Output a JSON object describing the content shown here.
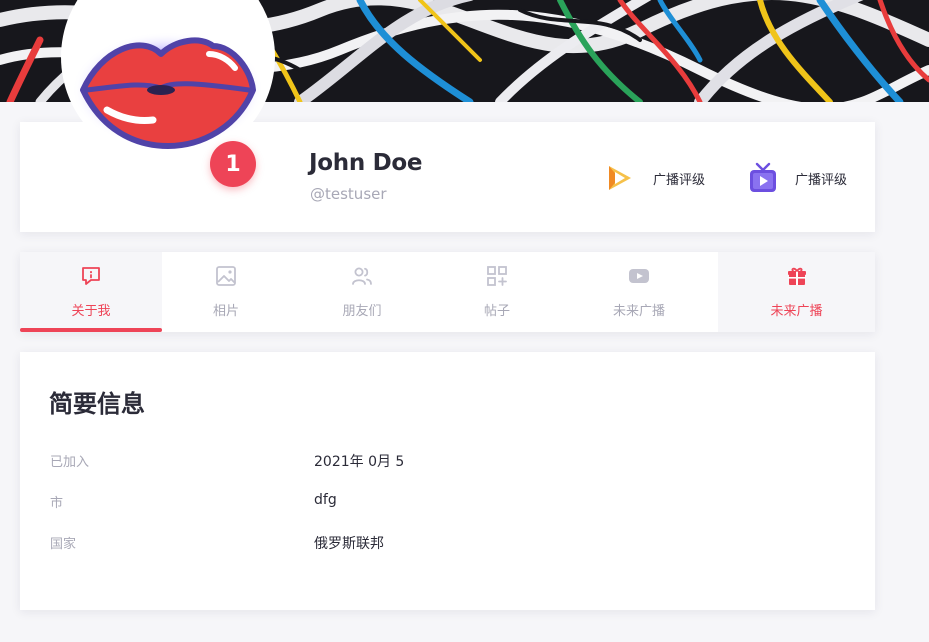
{
  "profile": {
    "name": "John Doe",
    "handle": "@testuser",
    "level": "1",
    "ratings": [
      {
        "label": "广播评级",
        "icon": "play-flame-icon",
        "color": "#f3a03a"
      },
      {
        "label": "广播评级",
        "icon": "tv-play-icon",
        "color": "#6c4fe0"
      }
    ]
  },
  "tabs": [
    {
      "label": "关于我",
      "icon": "info-message-icon",
      "active": true
    },
    {
      "label": "相片",
      "icon": "image-icon"
    },
    {
      "label": "朋友们",
      "icon": "users-icon"
    },
    {
      "label": "帖子",
      "icon": "grid-plus-icon"
    },
    {
      "label": "未来广播",
      "icon": "youtube-icon"
    },
    {
      "label": "未来广播",
      "icon": "gift-icon",
      "highlight": true
    }
  ],
  "info": {
    "title": "简要信息",
    "rows": [
      {
        "key": "已加入",
        "value": "2021年 0月 5"
      },
      {
        "key": "市",
        "value": "dfg"
      },
      {
        "key": "国家",
        "value": "俄罗斯联邦"
      }
    ]
  },
  "colors": {
    "accent": "#ee4457",
    "muted": "#a8a8b6",
    "text": "#2b2b38",
    "background": "#f6f6f9"
  }
}
